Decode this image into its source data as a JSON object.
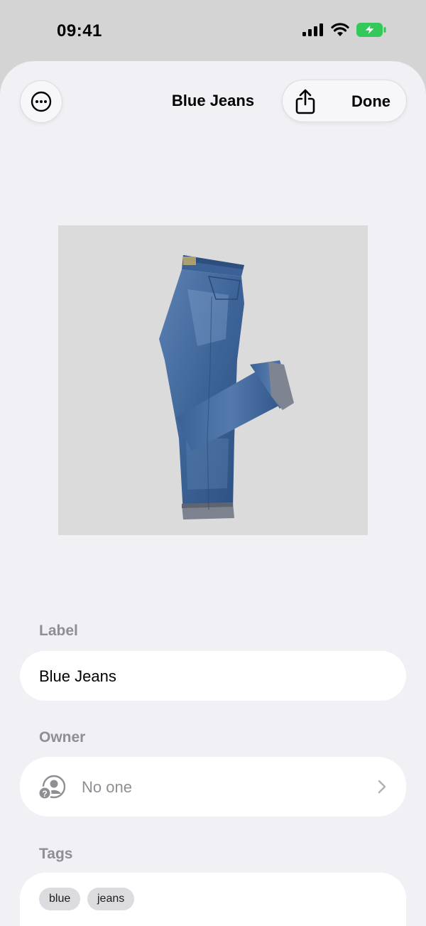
{
  "status_bar": {
    "time": "09:41"
  },
  "nav": {
    "title": "Blue Jeans",
    "done_label": "Done",
    "more_icon": "ellipsis-circle-icon",
    "share_icon": "share-icon"
  },
  "photo": {
    "subject": "jeans-photo"
  },
  "form": {
    "label_section": "Label",
    "label_value": "Blue Jeans",
    "owner_section": "Owner",
    "owner_value": "No one",
    "tags_section": "Tags",
    "tags": [
      "blue",
      "jeans"
    ]
  },
  "colors": {
    "sheet_bg": "#f0f0f5",
    "field_bg": "#ffffff",
    "secondary_text": "#8e8e93",
    "battery_green": "#34c759",
    "denim": "#3a5f92"
  }
}
